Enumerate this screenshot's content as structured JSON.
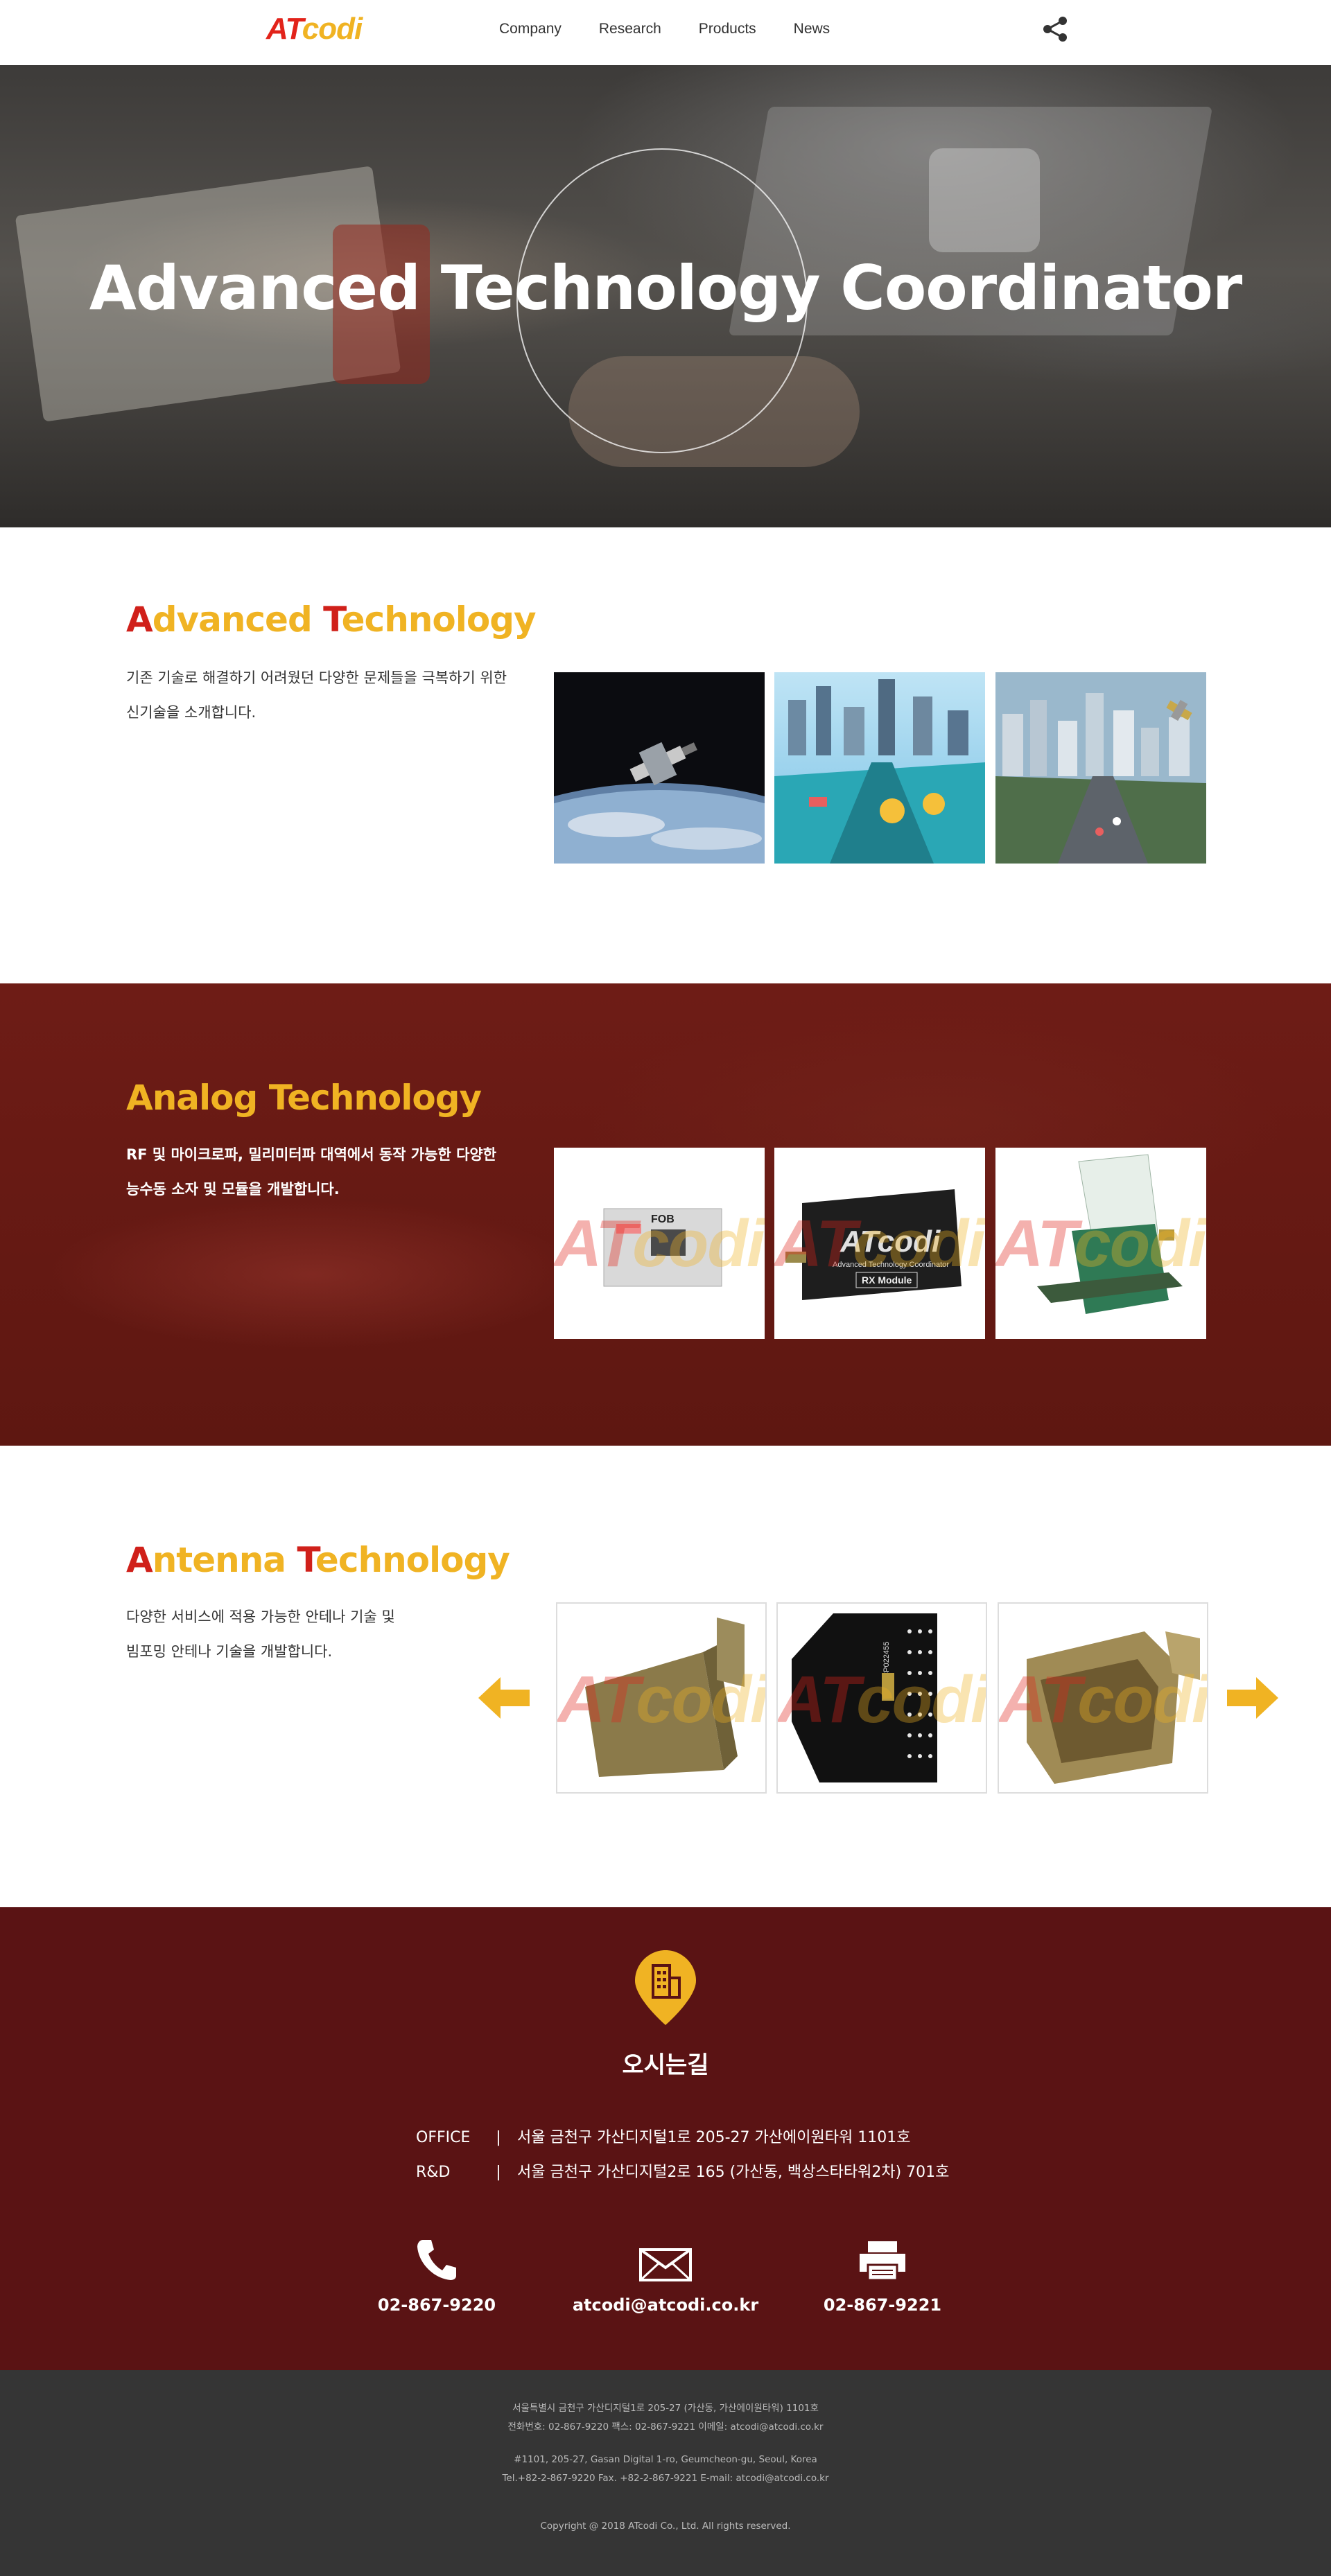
{
  "header": {
    "logo_prefix": "AT",
    "logo_suffix": "codi",
    "nav": [
      "Company",
      "Research",
      "Products",
      "News"
    ],
    "share_icon": "share-icon"
  },
  "hero": {
    "title": "Advanced Technology Coordinator"
  },
  "sections": {
    "advanced": {
      "title_initial1": "A",
      "title_rest1": "dvanced ",
      "title_initial2": "T",
      "title_rest2": "echnology",
      "desc_line1": "기존 기술로 해결하기 어려웠던 다양한 문제들을 극복하기 위한",
      "desc_line2": "신기술을 소개합니다."
    },
    "analog": {
      "title": "Analog Technology",
      "desc_line1": "RF 및 마이크로파, 밀리미터파 대역에서 동작 가능한 다양한",
      "desc_line2": "능수동 소자 및 모듈을 개발합니다.",
      "tile_labels": [
        "FOB",
        "ATcodi",
        "RX Module",
        "Advanced Technology Coordinator"
      ]
    },
    "antenna": {
      "title_initial1": "A",
      "title_rest1": "ntenna ",
      "title_initial2": "T",
      "title_rest2": "echnology",
      "desc_line1": "다양한 서비스에 적용 가능한 안테나 기술 및",
      "desc_line2": "빔포밍 안테나 기술을 개발합니다.",
      "board_label": "ATCP022455"
    }
  },
  "contact": {
    "title": "오시는길",
    "office_label": "OFFICE",
    "office_addr": "서울 금천구 가산디지털1로 205-27 가산에이원타워 1101호",
    "rd_label": "R&D",
    "rd_addr": "서울 금천구 가산디지털2로 165 (가산동, 백상스타타워2차) 701호",
    "separator": "|",
    "phone": "02-867-9220",
    "email": "atcodi@atcodi.co.kr",
    "fax": "02-867-9221"
  },
  "footer": {
    "ko_line1": "서울특별시 금천구 가산디지털1로 205-27 (가산동, 가산에이원타워) 1101호",
    "ko_line2": "전화번호: 02-867-9220 팩스: 02-867-9221 이메일: atcodi@atcodi.co.kr",
    "en_line1": "#1101, 205-27, Gasan Digital 1-ro, Geumcheon-gu, Seoul, Korea",
    "en_line2": "Tel.+82-2-867-9220 Fax. +82-2-867-9221 E-mail: atcodi@atcodi.co.kr",
    "copyright": "Copyright @ 2018 ATcodi Co., Ltd. All rights reserved."
  },
  "colors": {
    "brand_red": "#d0201a",
    "brand_yellow": "#f0b323",
    "contact_bg": "#5a1314",
    "footer_bg": "#353535"
  }
}
